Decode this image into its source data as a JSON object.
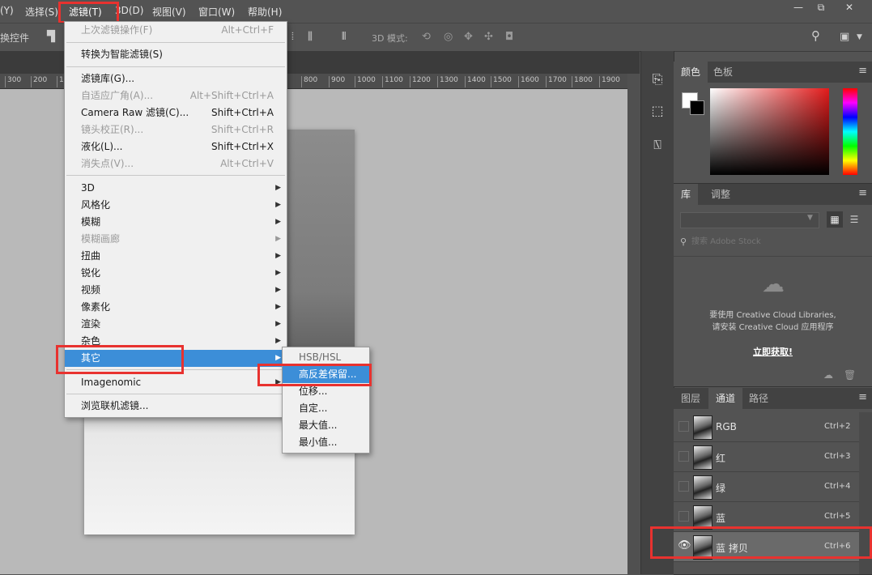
{
  "menubar": {
    "items": [
      "(Y)",
      "选择(S)",
      "滤镜(T)",
      "3D(D)",
      "视图(V)",
      "窗口(W)",
      "帮助(H)"
    ]
  },
  "window_controls": {
    "minimize": "—",
    "restore": "⧉",
    "close": "✕"
  },
  "options_bar": {
    "left_label": "换控件",
    "mode_label": "3D 模式:"
  },
  "ruler": {
    "ticks": [
      "300",
      "200",
      "100",
      "800",
      "900",
      "1000",
      "1100",
      "1200",
      "1300",
      "1400",
      "1500",
      "1600",
      "1700",
      "1800",
      "1900"
    ]
  },
  "filter_menu": {
    "items": [
      {
        "label": "上次滤镜操作(F)",
        "shortcut": "Alt+Ctrl+F",
        "disabled": true
      },
      {
        "label": "转换为智能滤镜(S)",
        "shortcut": "",
        "disabled": false
      },
      {
        "label": "滤镜库(G)...",
        "shortcut": "",
        "disabled": false
      },
      {
        "label": "自适应广角(A)...",
        "shortcut": "Alt+Shift+Ctrl+A",
        "disabled": true
      },
      {
        "label": "Camera Raw 滤镜(C)...",
        "shortcut": "Shift+Ctrl+A",
        "disabled": false
      },
      {
        "label": "镜头校正(R)...",
        "shortcut": "Shift+Ctrl+R",
        "disabled": true
      },
      {
        "label": "液化(L)...",
        "shortcut": "Shift+Ctrl+X",
        "disabled": false
      },
      {
        "label": "消失点(V)...",
        "shortcut": "Alt+Ctrl+V",
        "disabled": true
      },
      {
        "label": "3D",
        "submenu": true,
        "disabled": false
      },
      {
        "label": "风格化",
        "submenu": true,
        "disabled": false
      },
      {
        "label": "模糊",
        "submenu": true,
        "disabled": false
      },
      {
        "label": "模糊画廊",
        "submenu": true,
        "disabled": true
      },
      {
        "label": "扭曲",
        "submenu": true,
        "disabled": false
      },
      {
        "label": "锐化",
        "submenu": true,
        "disabled": false
      },
      {
        "label": "视频",
        "submenu": true,
        "disabled": false
      },
      {
        "label": "像素化",
        "submenu": true,
        "disabled": false
      },
      {
        "label": "渲染",
        "submenu": true,
        "disabled": false
      },
      {
        "label": "杂色",
        "submenu": true,
        "disabled": false
      },
      {
        "label": "其它",
        "submenu": true,
        "disabled": false,
        "highlighted": true
      },
      {
        "label": "Imagenomic",
        "submenu": true,
        "disabled": false
      },
      {
        "label": "浏览联机滤镜...",
        "shortcut": "",
        "disabled": false
      }
    ]
  },
  "other_submenu": {
    "items": [
      {
        "label": "HSB/HSL",
        "highlighted": false
      },
      {
        "label": "高反差保留...",
        "highlighted": true
      },
      {
        "label": "位移...",
        "highlighted": false
      },
      {
        "label": "自定...",
        "highlighted": false
      },
      {
        "label": "最大值...",
        "highlighted": false
      },
      {
        "label": "最小值...",
        "highlighted": false
      }
    ]
  },
  "color_panel": {
    "tabs": [
      "颜色",
      "色板"
    ]
  },
  "library_panel": {
    "tabs": [
      "库",
      "调整"
    ],
    "search_placeholder": "搜索 Adobe Stock",
    "message_line1": "要使用 Creative Cloud Libraries,",
    "message_line2": "请安装 Creative Cloud 应用程序",
    "link": "立即获取!"
  },
  "channels_panel": {
    "tabs": [
      "图层",
      "通道",
      "路径"
    ],
    "rows": [
      {
        "name": "RGB",
        "shortcut": "Ctrl+2",
        "visible": false,
        "selected": false
      },
      {
        "name": "红",
        "shortcut": "Ctrl+3",
        "visible": false,
        "selected": false
      },
      {
        "name": "绿",
        "shortcut": "Ctrl+4",
        "visible": false,
        "selected": false
      },
      {
        "name": "蓝",
        "shortcut": "Ctrl+5",
        "visible": false,
        "selected": false
      },
      {
        "name": "蓝 拷贝",
        "shortcut": "Ctrl+6",
        "visible": true,
        "selected": true
      }
    ]
  },
  "colors": {
    "accent_highlight": "#3c8ed8",
    "annotation_red": "#e8322f"
  }
}
